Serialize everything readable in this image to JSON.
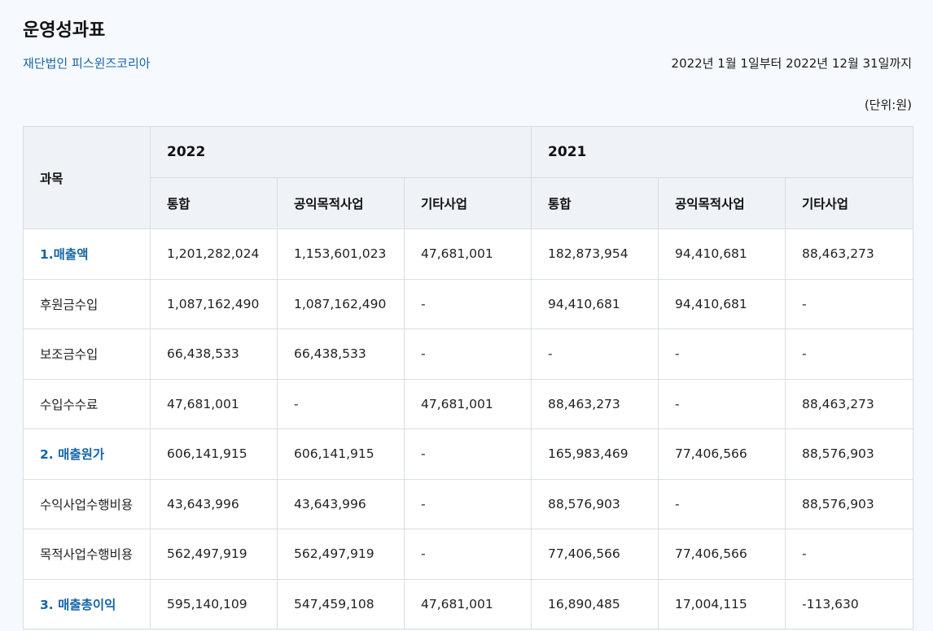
{
  "header": {
    "title": "운영성과표",
    "organization": "재단법인 피스윈즈코리아",
    "period": "2022년 1월 1일부터 2022년 12월 31일까지",
    "unit": "(단위:원)"
  },
  "table": {
    "subject_header": "과목",
    "years": [
      "2022",
      "2021"
    ],
    "sub_headers": [
      "통합",
      "공익목적사업",
      "기타사업",
      "통합",
      "공익목적사업",
      "기타사업"
    ],
    "rows": [
      {
        "subject": "1.매출액",
        "highlight": true,
        "values": [
          "1,201,282,024",
          "1,153,601,023",
          "47,681,001",
          "182,873,954",
          "94,410,681",
          "88,463,273"
        ]
      },
      {
        "subject": "후원금수입",
        "highlight": false,
        "values": [
          "1,087,162,490",
          "1,087,162,490",
          "-",
          "94,410,681",
          "94,410,681",
          "-"
        ]
      },
      {
        "subject": "보조금수입",
        "highlight": false,
        "values": [
          "66,438,533",
          "66,438,533",
          "-",
          "-",
          "-",
          "-"
        ]
      },
      {
        "subject": "수입수수료",
        "highlight": false,
        "values": [
          "47,681,001",
          "-",
          "47,681,001",
          "88,463,273",
          "-",
          "88,463,273"
        ]
      },
      {
        "subject": "2. 매출원가",
        "highlight": true,
        "values": [
          "606,141,915",
          "606,141,915",
          "-",
          "165,983,469",
          "77,406,566",
          "88,576,903"
        ]
      },
      {
        "subject": "수익사업수행비용",
        "highlight": false,
        "values": [
          "43,643,996",
          "43,643,996",
          "-",
          "88,576,903",
          "-",
          "88,576,903"
        ]
      },
      {
        "subject": "목적사업수행비용",
        "highlight": false,
        "values": [
          "562,497,919",
          "562,497,919",
          "-",
          "77,406,566",
          "77,406,566",
          "-"
        ]
      },
      {
        "subject": "3. 매출총이익",
        "highlight": true,
        "values": [
          "595,140,109",
          "547,459,108",
          "47,681,001",
          "16,890,485",
          "17,004,115",
          "-113,630"
        ]
      }
    ]
  }
}
